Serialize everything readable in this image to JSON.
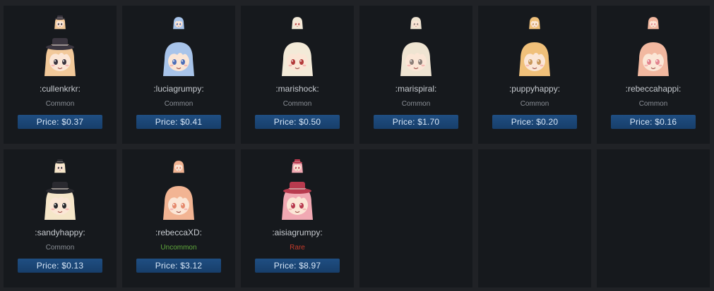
{
  "cards": [
    {
      "name": ":cullenkrkr:",
      "rarity": "Common",
      "price_label": "Price: $0.37",
      "hair": "#f2c99a",
      "accent": "#3b3640",
      "has_hat": true
    },
    {
      "name": ":luciagrumpy:",
      "rarity": "Common",
      "price_label": "Price: $0.41",
      "hair": "#a8c4ea",
      "accent": "#4e6fb8",
      "has_hat": false
    },
    {
      "name": ":marishock:",
      "rarity": "Common",
      "price_label": "Price: $0.50",
      "hair": "#f3ead8",
      "accent": "#b33a3a",
      "has_hat": false
    },
    {
      "name": ":marispiral:",
      "rarity": "Common",
      "price_label": "Price: $1.70",
      "hair": "#efe4d2",
      "accent": "#8c7f78",
      "has_hat": false
    },
    {
      "name": ":puppyhappy:",
      "rarity": "Common",
      "price_label": "Price: $0.20",
      "hair": "#f0c07a",
      "accent": "#c8975b",
      "has_hat": false
    },
    {
      "name": ":rebeccahappi:",
      "rarity": "Common",
      "price_label": "Price: $0.16",
      "hair": "#f2b8a0",
      "accent": "#e2848e",
      "has_hat": false
    },
    {
      "name": ":sandyhappy:",
      "rarity": "Common",
      "price_label": "Price: $0.13",
      "hair": "#f5e6c9",
      "accent": "#2a2a30",
      "has_hat": true
    },
    {
      "name": ":rebeccaXD:",
      "rarity": "Uncommon",
      "price_label": "Price: $3.12",
      "hair": "#f2b493",
      "accent": "#e58a6d",
      "has_hat": false
    },
    {
      "name": ":aisiagrumpy:",
      "rarity": "Rare",
      "price_label": "Price: $8.97",
      "hair": "#f1a9b3",
      "accent": "#b83a4e",
      "has_hat": true
    }
  ],
  "colors": {
    "card_bg": "#16191d",
    "page_bg": "#202226",
    "price_button": "#1f4e82",
    "common": "#8a8f96",
    "uncommon": "#5fa83b",
    "rare": "#c53a2a"
  }
}
